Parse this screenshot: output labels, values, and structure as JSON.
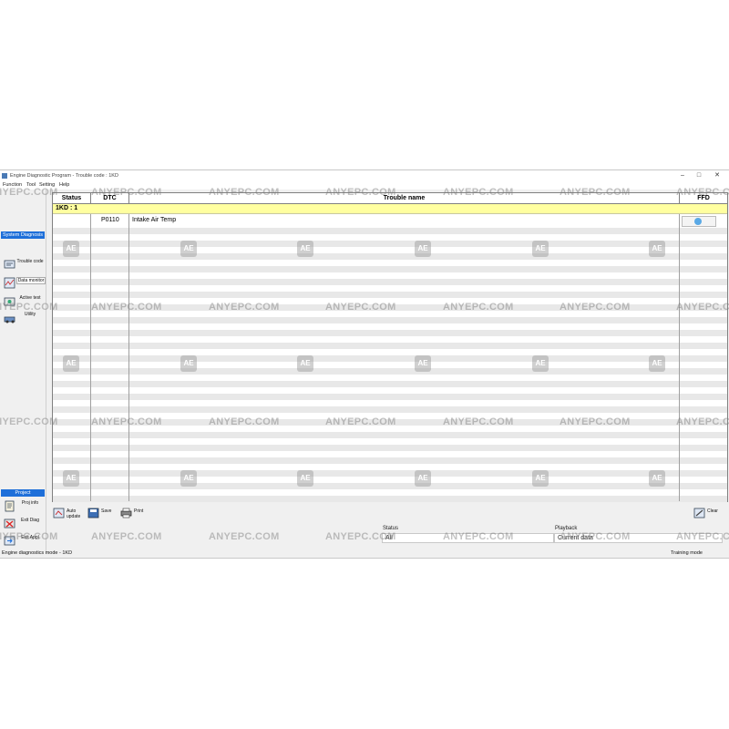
{
  "window": {
    "title": "Engine Diagnostic Program - Trouble code : 1KD",
    "controls": [
      "–",
      "□",
      "✕"
    ]
  },
  "menu": [
    "Function",
    "Tool",
    "Setting",
    "Help"
  ],
  "sidebar": {
    "header": "System Diagnosis",
    "items": [
      {
        "label": "Trouble code",
        "icon": "trouble-code-icon"
      },
      {
        "label": "Data monitor",
        "icon": "data-monitor-icon"
      },
      {
        "label": "Active test",
        "icon": "active-test-icon"
      },
      {
        "label": "Utility",
        "icon": "utility-icon"
      }
    ],
    "project_header": "Project",
    "project_items": [
      {
        "label": "Proj info",
        "icon": "project-info-icon"
      },
      {
        "label": "Exit Diag",
        "icon": "exit-diag-icon"
      },
      {
        "label": "Exit Appl",
        "icon": "exit-appl-icon"
      }
    ]
  },
  "table": {
    "columns": [
      "Status",
      "DTC",
      "Trouble name",
      "FFD"
    ],
    "group_label": "1KD : 1",
    "rows": [
      {
        "status": "",
        "dtc": "P0110",
        "name": "Intake Air Temp"
      }
    ]
  },
  "toolbar": {
    "auto_update": "Auto update",
    "save": "Save",
    "print": "Print",
    "clear": "Clear"
  },
  "filters": {
    "status_label": "Status",
    "status_value": "All",
    "playback_label": "Playback",
    "playback_value": "Current data"
  },
  "statusbar": {
    "left": "Engine diagnostics mode - 1KD",
    "right": "Training mode"
  },
  "watermark": {
    "text": "ANYEPC.COM",
    "logo": "AE"
  },
  "colors": {
    "accent": "#1e6fd9",
    "group_row": "#ffffa0",
    "ffd_indicator": "#5aa9e6"
  }
}
